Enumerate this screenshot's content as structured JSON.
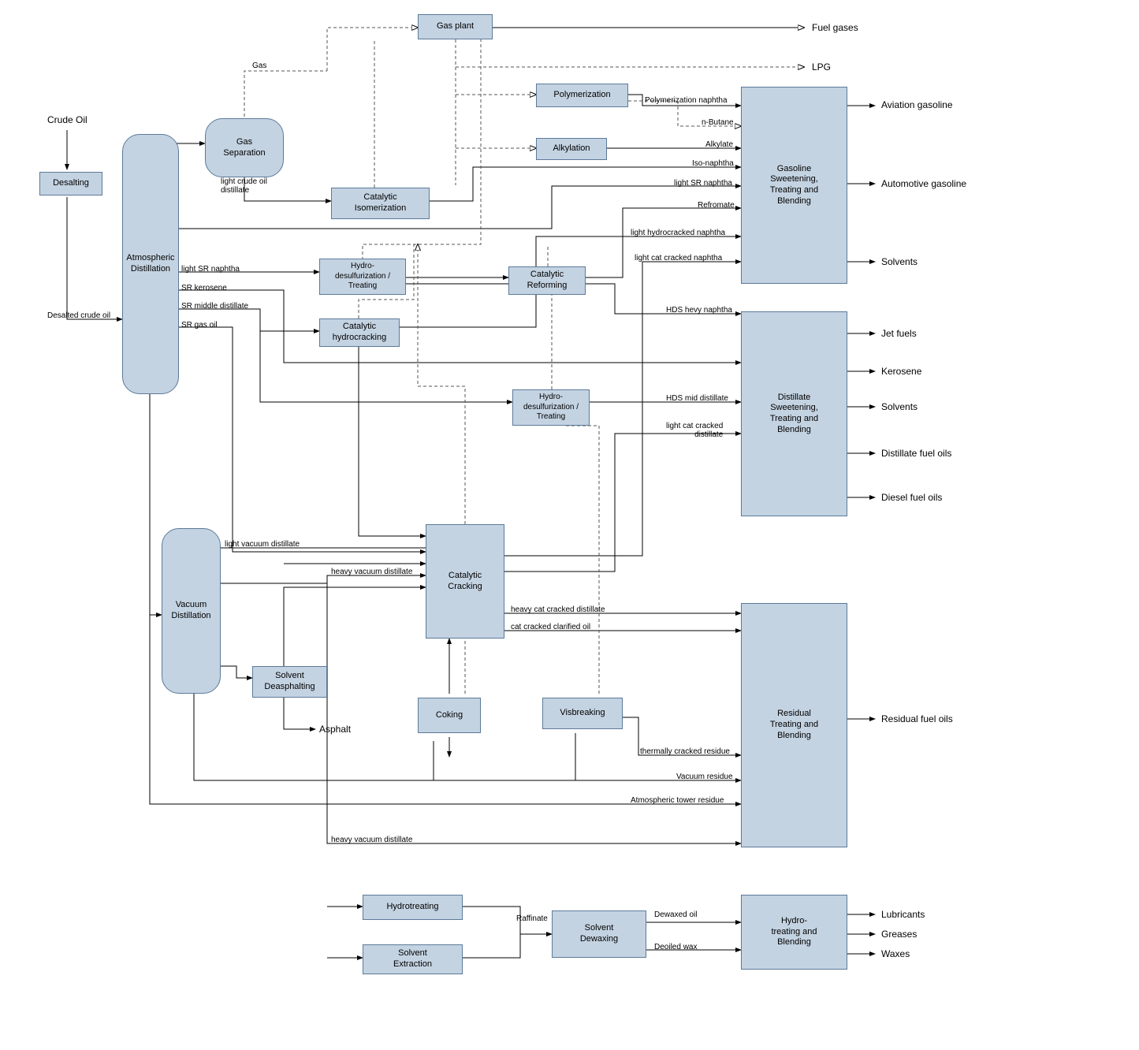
{
  "input": "Crude Oil",
  "nodes": {
    "desalting": "Desalting",
    "gas_plant": "Gas plant",
    "gas_separation": "Gas\nSeparation",
    "polymerization": "Polymerization",
    "alkylation": "Alkylation",
    "catalytic_isomerization": "Catalytic\nIsomerization",
    "atmospheric_distillation": "Atmospheric\nDistillation",
    "hydro_desulf_treat_1": "Hydro-\ndesulfurization /\nTreating",
    "catalytic_reforming": "Catalytic\nReforming",
    "catalytic_hydrocracking": "Catalytic\nhydrocracking",
    "hydro_desulf_treat_2": "Hydro-\ndesulfurization /\nTreating",
    "gasoline_blending": "Gasoline\nSweetening,\nTreating and\nBlending",
    "distillate_blending": "Distillate\nSweetening,\nTreating and\nBlending",
    "vacuum_distillation": "Vacuum\nDistillation",
    "catalytic_cracking": "Catalytic\nCracking",
    "solvent_deasphalting": "Solvent\nDeasphalting",
    "coking": "Coking",
    "visbreaking": "Visbreaking",
    "residual_blending": "Residual\nTreating and\nBlending",
    "hydrotreating": "Hydrotreating",
    "solvent_extraction": "Solvent\nExtraction",
    "solvent_dewaxing": "Solvent\nDewaxing",
    "hydro_treating_blending": "Hydro-\ntreating and\nBlending"
  },
  "edge_labels": {
    "gas": "Gas",
    "light_crude_oil_distillate": "light crude oil\ndistillate",
    "desalted_crude_oil": "Desalted crude oil",
    "light_sr_naphtha_left": "light SR naphtha",
    "sr_kerosene": "SR kerosene",
    "sr_middle_distillate": "SR middle distillate",
    "sr_gas_oil": "SR gas oil",
    "polymerization_naphtha": "Polymerization naphtha",
    "n_butane": "n-Butane",
    "alkylate": "Alkylate",
    "iso_naphtha": "Iso-naphtha",
    "light_sr_naphtha_right": "light SR naphtha",
    "refromate": "Refromate",
    "light_hydrocracked_naphtha": "light hydrocracked naphtha",
    "light_cat_cracked_naphtha": "light cat cracked naphtha",
    "hds_hevy_naphtha": "HDS hevy naphtha",
    "hds_mid_distillate": "HDS mid distillate",
    "light_cat_cracked_distillate": "light cat cracked\ndistillate",
    "light_vacuum_distillate": "light vacuum distillate",
    "heavy_vacuum_distillate_1": "heavy vacuum distillate",
    "heavy_cat_cracked_distillate": "heavy cat cracked distillate",
    "cat_cracked_clarified_oil": "cat cracked clarified oil",
    "asphalt": "Asphalt",
    "thermally_cracked_residue": "thermally cracked residue",
    "vacuum_residue": "Vacuum residue",
    "atmospheric_tower_residue": "Atmospheric tower residue",
    "heavy_vacuum_distillate_2": "heavy vacuum distillate",
    "raffinate": "Raffinate",
    "dewaxed_oil": "Dewaxed oil",
    "deoiled_wax": "Deoiled wax"
  },
  "outputs": {
    "fuel_gases": "Fuel gases",
    "lpg": "LPG",
    "aviation_gasoline": "Aviation gasoline",
    "automotive_gasoline": "Automotive gasoline",
    "solvents_1": "Solvents",
    "jet_fuels": "Jet fuels",
    "kerosene": "Kerosene",
    "solvents_2": "Solvents",
    "distillate_fuel_oils": "Distillate fuel oils",
    "diesel_fuel_oils": "Diesel fuel oils",
    "residual_fuel_oils": "Residual fuel oils",
    "lubricants": "Lubricants",
    "greases": "Greases",
    "waxes": "Waxes"
  }
}
